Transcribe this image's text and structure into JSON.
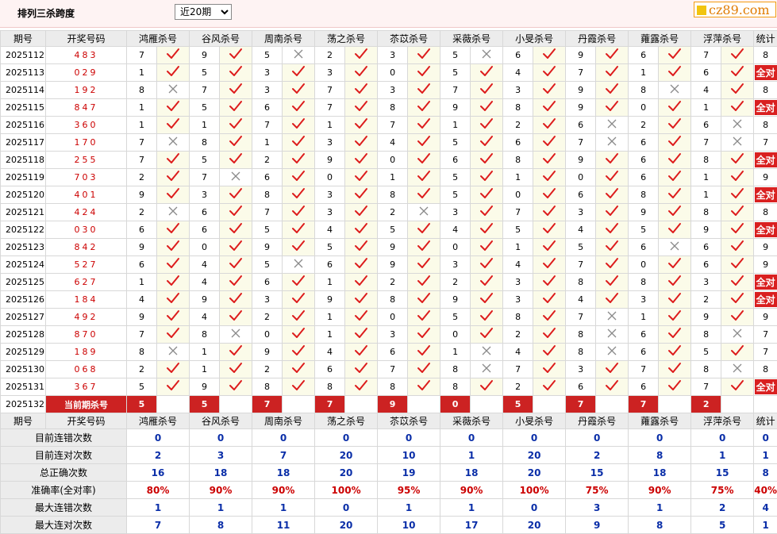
{
  "header": {
    "title": "排列三杀跨度",
    "period_selected": "近20期",
    "logo_text": "cz89.com"
  },
  "table": {
    "col_issue": "期号",
    "col_win": "开奖号码",
    "col_stat": "统计",
    "experts": [
      "鸿雁杀号",
      "谷风杀号",
      "周南杀号",
      "荡之杀号",
      "苶苡杀号",
      "采薇杀号",
      "小旻杀号",
      "丹霞杀号",
      "蕹露杀号",
      "浮萍杀号"
    ],
    "all_correct_label": "全对",
    "rows": [
      {
        "issue": "2025112",
        "win": "483",
        "k": [
          "7",
          "9",
          "5",
          "2",
          "3",
          "5",
          "6",
          "9",
          "6",
          "7"
        ],
        "ok": [
          1,
          1,
          0,
          1,
          1,
          0,
          1,
          1,
          1,
          1
        ],
        "stat": "8"
      },
      {
        "issue": "2025113",
        "win": "029",
        "k": [
          "1",
          "5",
          "3",
          "3",
          "0",
          "5",
          "4",
          "7",
          "1",
          "6"
        ],
        "ok": [
          1,
          1,
          1,
          1,
          1,
          1,
          1,
          1,
          1,
          1
        ],
        "stat": "全对"
      },
      {
        "issue": "2025114",
        "win": "192",
        "k": [
          "8",
          "7",
          "3",
          "7",
          "3",
          "7",
          "3",
          "9",
          "8",
          "4"
        ],
        "ok": [
          0,
          1,
          1,
          1,
          1,
          1,
          1,
          1,
          0,
          1
        ],
        "stat": "8"
      },
      {
        "issue": "2025115",
        "win": "847",
        "k": [
          "1",
          "5",
          "6",
          "7",
          "8",
          "9",
          "8",
          "9",
          "0",
          "1"
        ],
        "ok": [
          1,
          1,
          1,
          1,
          1,
          1,
          1,
          1,
          1,
          1
        ],
        "stat": "全对"
      },
      {
        "issue": "2025116",
        "win": "360",
        "k": [
          "1",
          "1",
          "7",
          "1",
          "7",
          "1",
          "2",
          "6",
          "2",
          "6"
        ],
        "ok": [
          1,
          1,
          1,
          1,
          1,
          1,
          1,
          0,
          1,
          0
        ],
        "stat": "8"
      },
      {
        "issue": "2025117",
        "win": "170",
        "k": [
          "7",
          "8",
          "1",
          "3",
          "4",
          "5",
          "6",
          "7",
          "6",
          "7"
        ],
        "ok": [
          0,
          1,
          1,
          1,
          1,
          1,
          1,
          0,
          1,
          0
        ],
        "stat": "7"
      },
      {
        "issue": "2025118",
        "win": "255",
        "k": [
          "7",
          "5",
          "2",
          "9",
          "0",
          "6",
          "8",
          "9",
          "6",
          "8"
        ],
        "ok": [
          1,
          1,
          1,
          1,
          1,
          1,
          1,
          1,
          1,
          1
        ],
        "stat": "全对"
      },
      {
        "issue": "2025119",
        "win": "703",
        "k": [
          "2",
          "7",
          "6",
          "0",
          "1",
          "5",
          "1",
          "0",
          "6",
          "1"
        ],
        "ok": [
          1,
          0,
          1,
          1,
          1,
          1,
          1,
          1,
          1,
          1
        ],
        "stat": "9"
      },
      {
        "issue": "2025120",
        "win": "401",
        "k": [
          "9",
          "3",
          "8",
          "3",
          "8",
          "5",
          "0",
          "6",
          "8",
          "1"
        ],
        "ok": [
          1,
          1,
          1,
          1,
          1,
          1,
          1,
          1,
          1,
          1
        ],
        "stat": "全对"
      },
      {
        "issue": "2025121",
        "win": "424",
        "k": [
          "2",
          "6",
          "7",
          "3",
          "2",
          "3",
          "7",
          "3",
          "9",
          "8"
        ],
        "ok": [
          0,
          1,
          1,
          1,
          0,
          1,
          1,
          1,
          1,
          1
        ],
        "stat": "8"
      },
      {
        "issue": "2025122",
        "win": "030",
        "k": [
          "6",
          "6",
          "5",
          "4",
          "5",
          "4",
          "5",
          "4",
          "5",
          "9"
        ],
        "ok": [
          1,
          1,
          1,
          1,
          1,
          1,
          1,
          1,
          1,
          1
        ],
        "stat": "全对"
      },
      {
        "issue": "2025123",
        "win": "842",
        "k": [
          "9",
          "0",
          "9",
          "5",
          "9",
          "0",
          "1",
          "5",
          "6",
          "6"
        ],
        "ok": [
          1,
          1,
          1,
          1,
          1,
          1,
          1,
          1,
          0,
          1
        ],
        "stat": "9"
      },
      {
        "issue": "2025124",
        "win": "527",
        "k": [
          "6",
          "4",
          "5",
          "6",
          "9",
          "3",
          "4",
          "7",
          "0",
          "6"
        ],
        "ok": [
          1,
          1,
          0,
          1,
          1,
          1,
          1,
          1,
          1,
          1
        ],
        "stat": "9"
      },
      {
        "issue": "2025125",
        "win": "627",
        "k": [
          "1",
          "4",
          "6",
          "1",
          "2",
          "2",
          "3",
          "8",
          "8",
          "3"
        ],
        "ok": [
          1,
          1,
          1,
          1,
          1,
          1,
          1,
          1,
          1,
          1
        ],
        "stat": "全对"
      },
      {
        "issue": "2025126",
        "win": "184",
        "k": [
          "4",
          "9",
          "3",
          "9",
          "8",
          "9",
          "3",
          "4",
          "3",
          "2"
        ],
        "ok": [
          1,
          1,
          1,
          1,
          1,
          1,
          1,
          1,
          1,
          1
        ],
        "stat": "全对"
      },
      {
        "issue": "2025127",
        "win": "492",
        "k": [
          "9",
          "4",
          "2",
          "1",
          "0",
          "5",
          "8",
          "7",
          "1",
          "9"
        ],
        "ok": [
          1,
          1,
          1,
          1,
          1,
          1,
          1,
          0,
          1,
          1
        ],
        "stat": "9"
      },
      {
        "issue": "2025128",
        "win": "870",
        "k": [
          "7",
          "8",
          "0",
          "1",
          "3",
          "0",
          "2",
          "8",
          "6",
          "8"
        ],
        "ok": [
          1,
          0,
          1,
          1,
          1,
          1,
          1,
          0,
          1,
          0
        ],
        "stat": "7"
      },
      {
        "issue": "2025129",
        "win": "189",
        "k": [
          "8",
          "1",
          "9",
          "4",
          "6",
          "1",
          "4",
          "8",
          "6",
          "5"
        ],
        "ok": [
          0,
          1,
          1,
          1,
          1,
          0,
          1,
          0,
          1,
          1
        ],
        "stat": "7"
      },
      {
        "issue": "2025130",
        "win": "068",
        "k": [
          "2",
          "1",
          "2",
          "6",
          "7",
          "8",
          "7",
          "3",
          "7",
          "8"
        ],
        "ok": [
          1,
          1,
          1,
          1,
          1,
          0,
          1,
          1,
          1,
          0
        ],
        "stat": "8"
      },
      {
        "issue": "2025131",
        "win": "367",
        "k": [
          "5",
          "9",
          "8",
          "8",
          "8",
          "8",
          "2",
          "6",
          "6",
          "7"
        ],
        "ok": [
          1,
          1,
          1,
          1,
          1,
          1,
          1,
          1,
          1,
          1
        ],
        "stat": "全对"
      }
    ],
    "current": {
      "issue": "2025132",
      "label": "当前期杀号",
      "values": [
        "5",
        "5",
        "7",
        "7",
        "9",
        "0",
        "5",
        "7",
        "7",
        "2"
      ]
    },
    "stats": [
      {
        "label": "目前连错次数",
        "values": [
          "0",
          "0",
          "0",
          "0",
          "0",
          "0",
          "0",
          "0",
          "0",
          "0"
        ],
        "stat": "0",
        "color": "blue"
      },
      {
        "label": "目前连对次数",
        "values": [
          "2",
          "3",
          "7",
          "20",
          "10",
          "1",
          "20",
          "2",
          "8",
          "1"
        ],
        "stat": "1",
        "color": "blue"
      },
      {
        "label": "总正确次数",
        "values": [
          "16",
          "18",
          "18",
          "20",
          "19",
          "18",
          "20",
          "15",
          "18",
          "15"
        ],
        "stat": "8",
        "color": "blue"
      },
      {
        "label": "准确率(全对率)",
        "values": [
          "80%",
          "90%",
          "90%",
          "100%",
          "95%",
          "90%",
          "100%",
          "75%",
          "90%",
          "75%"
        ],
        "stat": "40%",
        "color": "red"
      },
      {
        "label": "最大连错次数",
        "values": [
          "1",
          "1",
          "1",
          "0",
          "1",
          "1",
          "0",
          "3",
          "1",
          "2"
        ],
        "stat": "4",
        "color": "blue"
      },
      {
        "label": "最大连对次数",
        "values": [
          "7",
          "8",
          "11",
          "20",
          "10",
          "17",
          "20",
          "9",
          "8",
          "5"
        ],
        "stat": "1",
        "color": "blue"
      }
    ]
  }
}
